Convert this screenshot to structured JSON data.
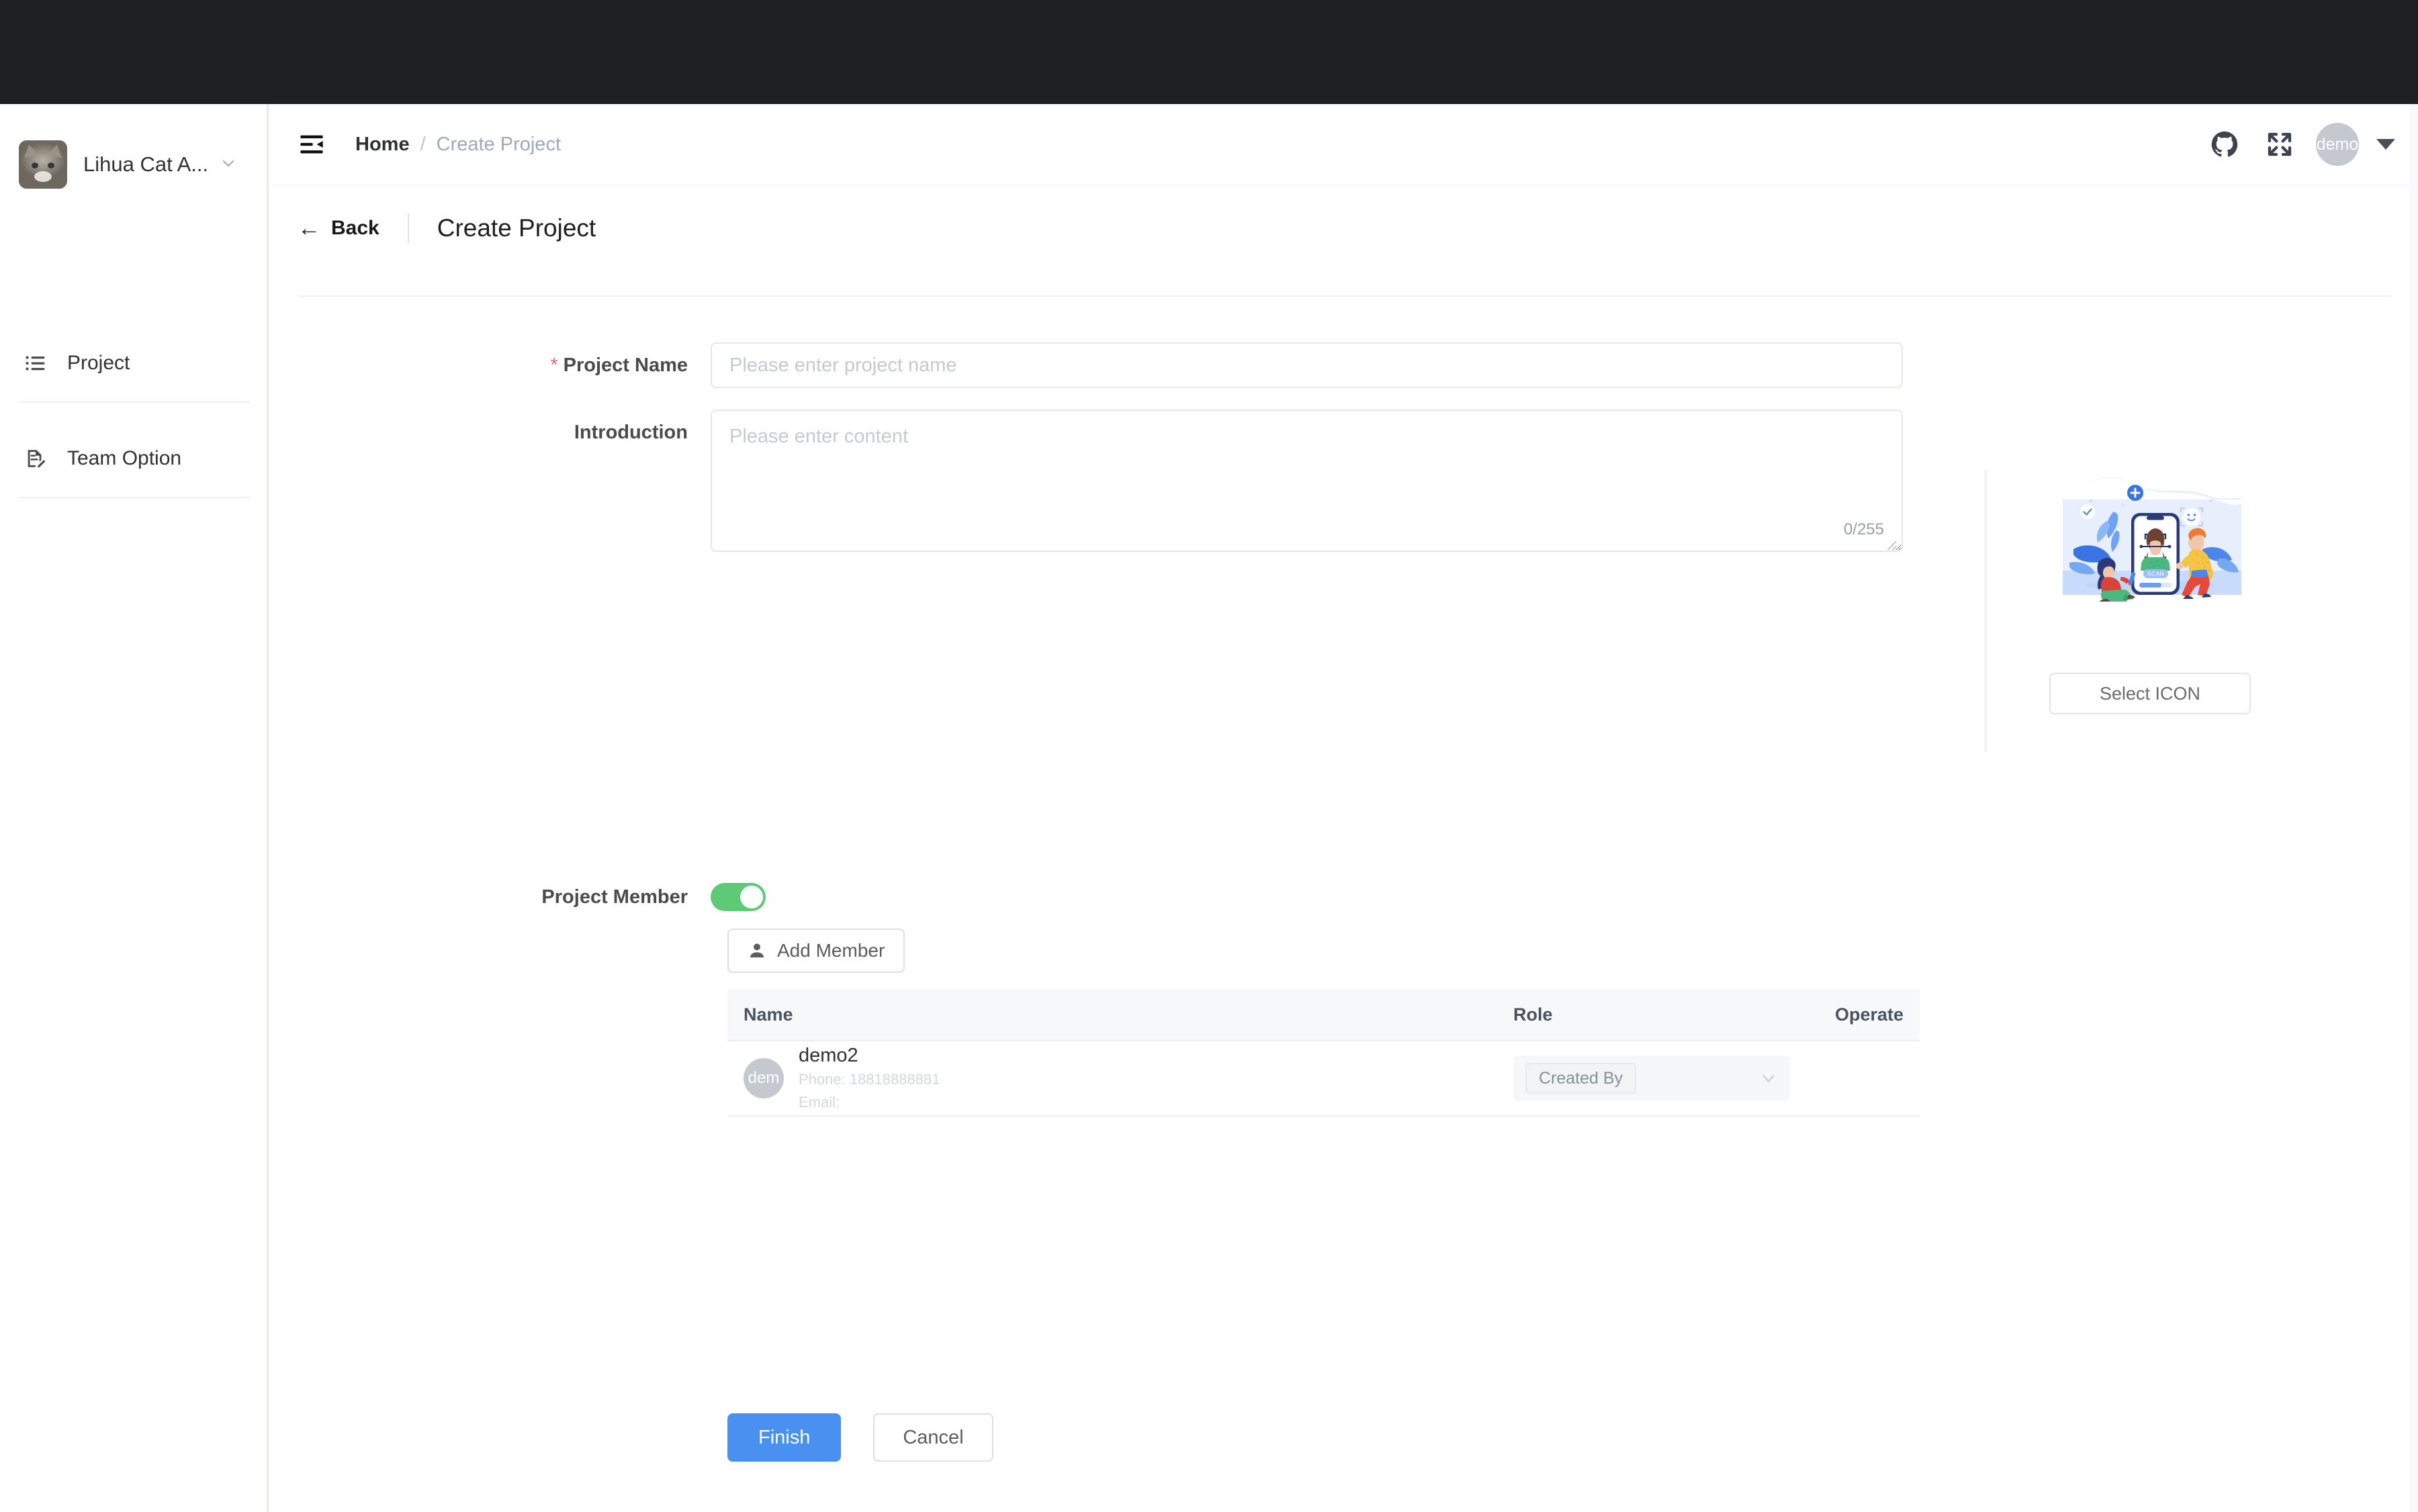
{
  "window": {
    "os_bar_color": "#1f2021"
  },
  "sidebar": {
    "team": {
      "name": "Lihua Cat A...",
      "avatar_icon": "cat-photo-avatar",
      "caret_icon": "chevron-down-icon"
    },
    "items": [
      {
        "label": "Project",
        "icon": "list-icon"
      },
      {
        "label": "Team Option",
        "icon": "document-edit-icon"
      }
    ]
  },
  "topbar": {
    "fold_icon": "menu-fold-icon",
    "breadcrumb": {
      "home": "Home",
      "separator": "/",
      "current": "Create Project"
    },
    "icons": [
      {
        "name": "github-icon"
      },
      {
        "name": "fullscreen-expand-icon"
      }
    ],
    "user": {
      "avatar_text": "demo",
      "caret_icon": "caret-down-icon"
    }
  },
  "page": {
    "back_label": "Back",
    "back_icon": "arrow-left-icon",
    "title": "Create Project"
  },
  "form": {
    "project_name": {
      "label": "Project Name",
      "required_marker": "*",
      "value": "",
      "placeholder": "Please enter project name"
    },
    "introduction": {
      "label": "Introduction",
      "value": "",
      "placeholder": "Please enter content",
      "counter": "0/255"
    },
    "project_member": {
      "label": "Project Member",
      "switch_on": true,
      "switch_color": "#5dca78",
      "add_member_label": "Add Member",
      "add_member_icon": "user-icon"
    },
    "table": {
      "columns": [
        "Name",
        "Role",
        "Operate"
      ],
      "rows": [
        {
          "avatar_text": "dem",
          "name": "demo2",
          "phone": "Phone: 18818888881",
          "email": "Email:",
          "role": "Created By",
          "role_caret_icon": "chevron-down-icon",
          "operate": ""
        }
      ]
    },
    "actions": {
      "finish_label": "Finish",
      "finish_color": "#4a90f0",
      "cancel_label": "Cancel"
    }
  },
  "icon_panel": {
    "illustration": "face-scan-illustration",
    "select_icon_label": "Select ICON"
  }
}
